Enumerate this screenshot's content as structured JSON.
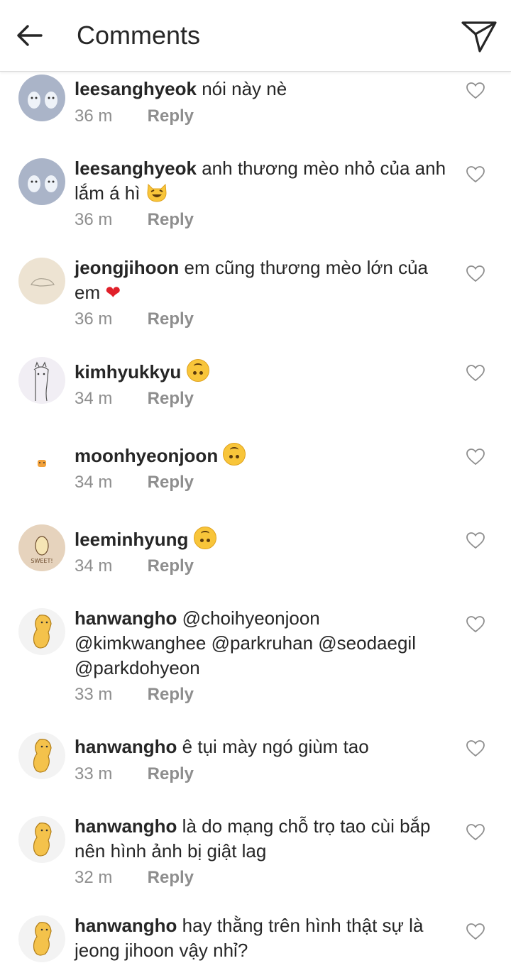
{
  "header": {
    "title": "Comments"
  },
  "comments": [
    {
      "username": "leesanghyeok",
      "text": "nói này nè",
      "time": "36 m",
      "reply": "Reply"
    },
    {
      "username": "leesanghyeok",
      "text": "anh thương mèo nhỏ của anh lắm á hì",
      "time": "36 m",
      "reply": "Reply",
      "emoji": "grinning-cat"
    },
    {
      "username": "jeongjihoon",
      "text": "em cũng thương mèo lớn của em",
      "time": "36 m",
      "reply": "Reply",
      "emoji": "red-heart"
    },
    {
      "username": "kimhyukkyu",
      "text": "",
      "time": "34 m",
      "reply": "Reply",
      "emoji": "upside-down-face"
    },
    {
      "username": "moonhyeonjoon",
      "text": "",
      "time": "34 m",
      "reply": "Reply",
      "emoji": "upside-down-face"
    },
    {
      "username": "leeminhyung",
      "text": "",
      "time": "34 m",
      "reply": "Reply",
      "emoji": "upside-down-face"
    },
    {
      "username": "hanwangho",
      "text": "@choihyeonjoon @kimkwanghee @parkruhan @seodaegil @parkdohyeon",
      "time": "33 m",
      "reply": "Reply"
    },
    {
      "username": "hanwangho",
      "text": "ê tụi mày ngó giùm tao",
      "time": "33 m",
      "reply": "Reply"
    },
    {
      "username": "hanwangho",
      "text": "là do mạng chỗ trọ tao cùi bắp nên hình ảnh bị giật lag",
      "time": "32 m",
      "reply": "Reply"
    },
    {
      "username": "hanwangho",
      "text": "hay thằng trên hình thật sự là jeong jihoon vậy nhỉ?",
      "time": "",
      "reply": ""
    }
  ],
  "avatar_texts": {
    "potato": "SWEET!"
  },
  "icons": {
    "back": "arrow-left-icon",
    "send": "paper-plane-icon",
    "like": "heart-outline-icon"
  },
  "colors": {
    "text": "#262626",
    "meta": "#8e8e8e",
    "divider": "#dbdbdb"
  }
}
